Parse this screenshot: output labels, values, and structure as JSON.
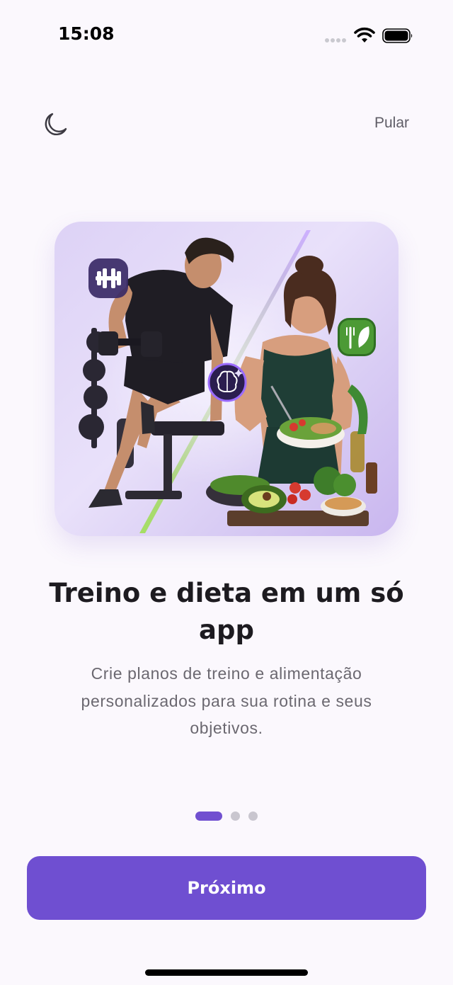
{
  "status_bar": {
    "time": "15:08"
  },
  "header": {
    "theme_icon": "moon-icon",
    "skip_label": "Pular"
  },
  "hero": {
    "illustration": "man lifting dumbbell and woman eating salad bowl",
    "badges": [
      "dumbbell-icon",
      "brain-sparkle-icon",
      "leaf-fork-icon"
    ]
  },
  "content": {
    "title": "Treino e dieta em um só app",
    "subtitle": "Crie planos de treino e alimentação personalizados para sua rotina e seus objetivos."
  },
  "pager": {
    "count": 3,
    "active_index": 0
  },
  "footer": {
    "next_label": "Próximo"
  },
  "colors": {
    "accent": "#6f4fd1",
    "background": "#fbf8fd",
    "green": "#6bbf3a"
  }
}
